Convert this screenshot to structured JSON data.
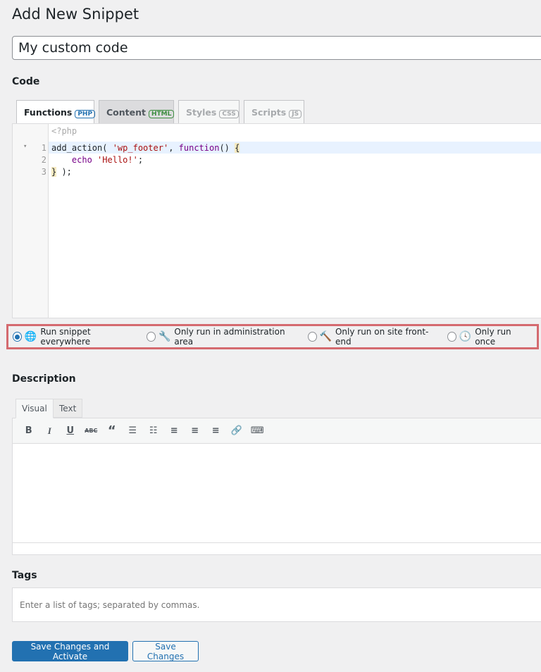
{
  "page": {
    "title": "Add New Snippet",
    "snippet_name": "My custom code"
  },
  "code": {
    "heading": "Code",
    "tabs": [
      {
        "label": "Functions",
        "badge": "PHP",
        "color": "#2271b1"
      },
      {
        "label": "Content",
        "badge": "HTML",
        "color": "#3e8e41"
      },
      {
        "label": "Styles",
        "badge": "CSS",
        "color": "#a7aaad"
      },
      {
        "label": "Scripts",
        "badge": "JS",
        "color": "#a7aaad"
      }
    ],
    "prefix": "<?php",
    "line_numbers": [
      "1",
      "2",
      "3"
    ]
  },
  "scope": {
    "options": [
      {
        "label": "Run snippet everywhere",
        "icon": "globe-icon",
        "selected": true
      },
      {
        "label": "Only run in administration area",
        "icon": "wrench-icon",
        "selected": false
      },
      {
        "label": "Only run on site front-end",
        "icon": "hammer-icon",
        "selected": false
      },
      {
        "label": "Only run once",
        "icon": "clock-icon",
        "selected": false
      }
    ]
  },
  "description": {
    "heading": "Description",
    "tabs": [
      "Visual",
      "Text"
    ],
    "toolbar": [
      "bold",
      "italic",
      "underline",
      "strikethrough",
      "blockquote",
      "bullet-list",
      "numbered-list",
      "align-left",
      "align-center",
      "align-right",
      "link",
      "toolbar-toggle"
    ]
  },
  "tags": {
    "heading": "Tags",
    "placeholder": "Enter a list of tags; separated by commas."
  },
  "actions": {
    "save_activate": "Save Changes and Activate",
    "save": "Save Changes"
  }
}
